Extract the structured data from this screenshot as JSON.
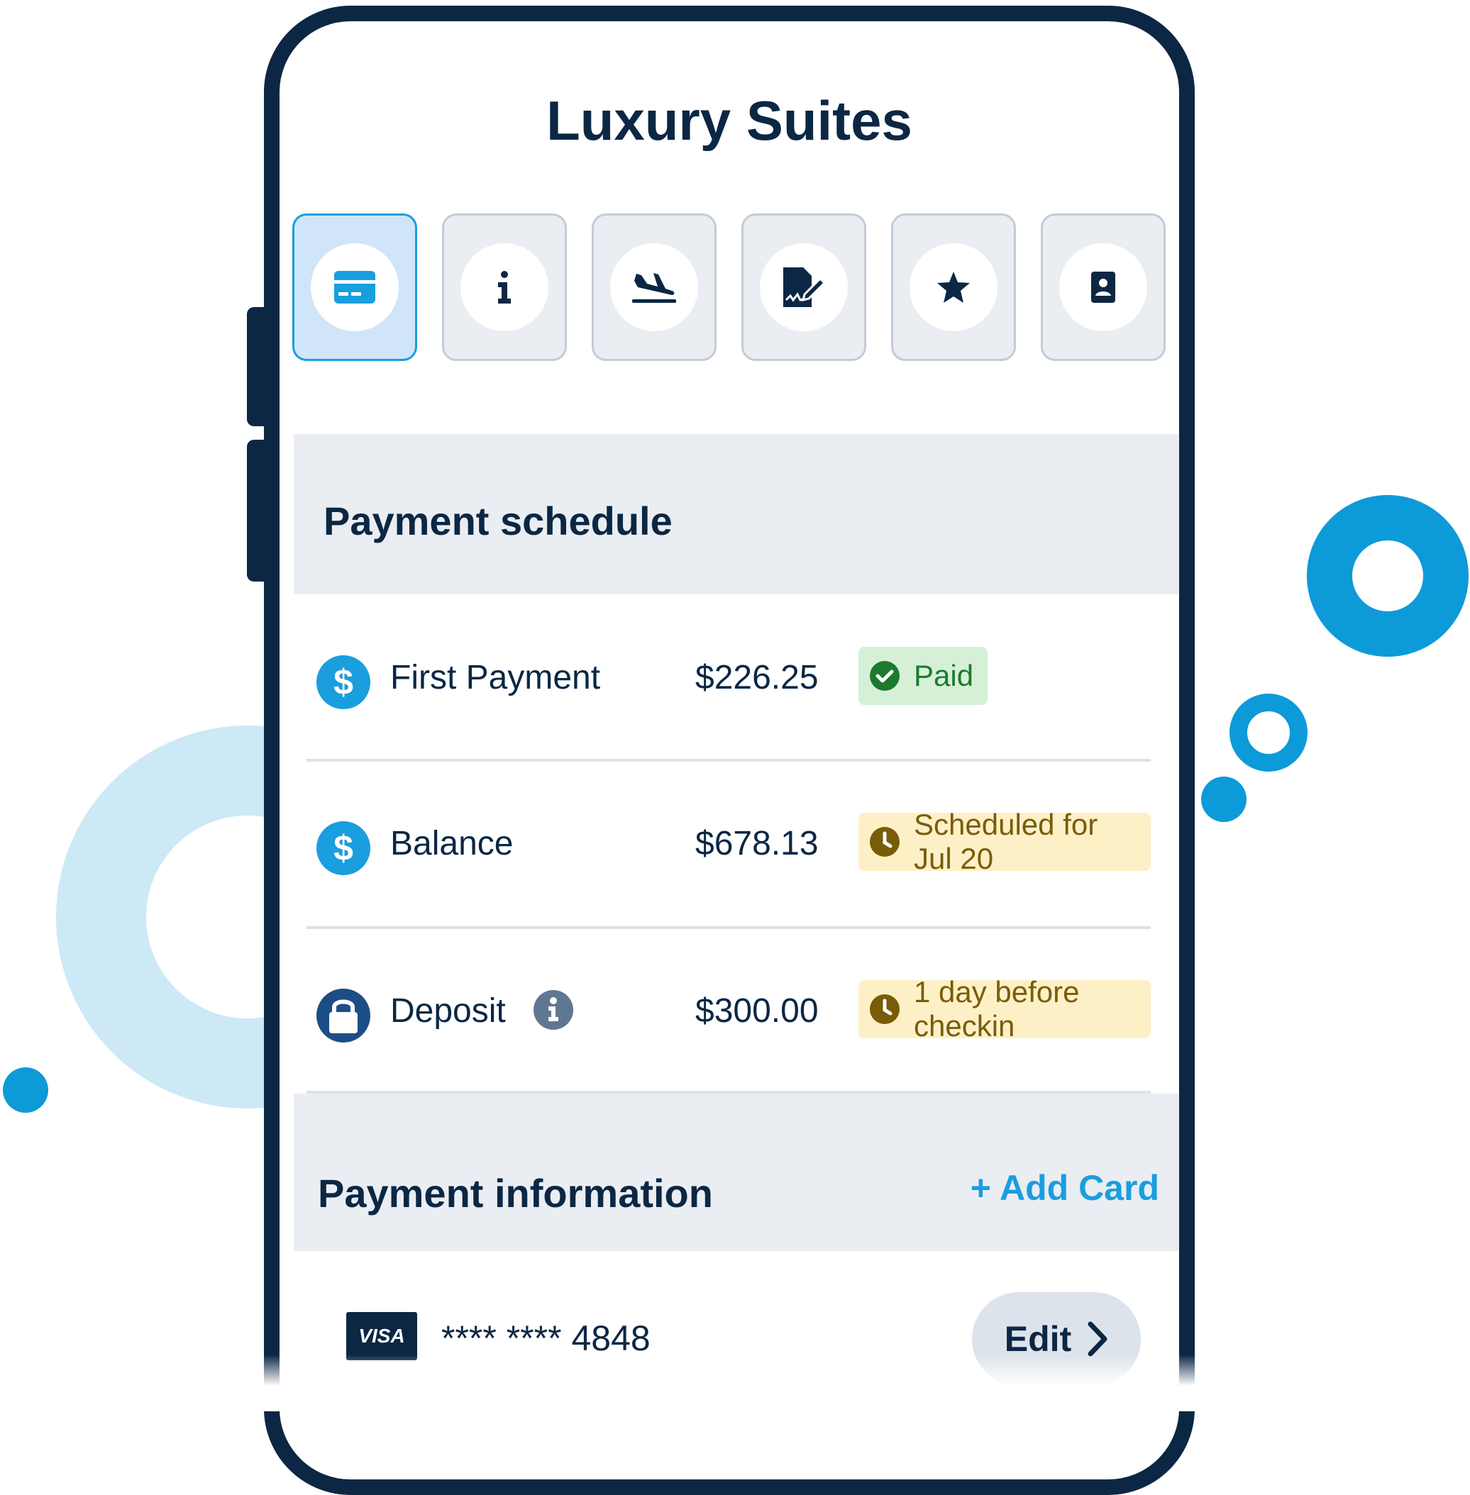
{
  "header": {
    "title": "Luxury Suites"
  },
  "tabs": [
    {
      "icon": "credit-card-icon",
      "active": true
    },
    {
      "icon": "info-icon",
      "active": false
    },
    {
      "icon": "plane-arrival-icon",
      "active": false
    },
    {
      "icon": "signed-document-icon",
      "active": false
    },
    {
      "icon": "star-icon",
      "active": false
    },
    {
      "icon": "contact-card-icon",
      "active": false
    }
  ],
  "payment_schedule": {
    "title": "Payment schedule",
    "rows": [
      {
        "icon": "dollar-icon",
        "label": "First Payment",
        "amount": "$226.25",
        "status": "Paid",
        "status_icon": "check-circle-icon",
        "status_color": "#1c7a2c"
      },
      {
        "icon": "dollar-icon",
        "label": "Balance",
        "amount": "$678.13",
        "status": "Scheduled for Jul 20",
        "status_icon": "clock-icon",
        "status_color": "#7a5c08"
      },
      {
        "icon": "lock-icon",
        "label": "Deposit",
        "info_icon": "info-circle-icon",
        "amount": "$300.00",
        "status": "1 day before checkin",
        "status_icon": "clock-icon",
        "status_color": "#7a5c08"
      }
    ]
  },
  "payment_information": {
    "title": "Payment information",
    "add_card_label": "+ Add Card",
    "card": {
      "brand": "VISA",
      "number": "**** **** 4848",
      "edit_label": "Edit"
    }
  },
  "colors": {
    "navy": "#0b2744",
    "accent": "#1a9ede",
    "paid_bg": "#d6f0d8",
    "pending_bg": "#fdf0c7",
    "section_bg": "#eaedf2"
  }
}
